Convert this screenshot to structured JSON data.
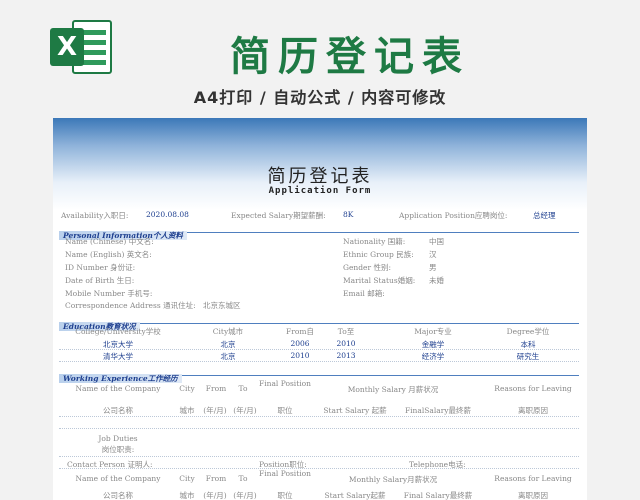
{
  "banner": {
    "icon_letter": "X",
    "title": "简历登记表",
    "subtitle": "A4打印 / 自动公式 / 内容可修改",
    "accent": "#1e7a44"
  },
  "doc": {
    "title": "简历登记表",
    "subtitle": "Application Form",
    "top_row": {
      "availability_label": "Availability入职日:",
      "availability_value": "2020.08.08",
      "salary_label": "Expected Salary期望薪酬:",
      "salary_value": "8K",
      "position_label": "Application Position应聘岗位:",
      "position_value": "总经理"
    },
    "personal": {
      "header": "Personal Information个人资料",
      "name_cn": "Name (Chinese) 中文名:",
      "name_en": "Name (English) 英文名:",
      "id": "ID Number 身份证:",
      "dob": "Date of Birth 生日:",
      "mobile": "Mobile Number 手机号:",
      "address_label": "Correspondence Address 通讯住址:",
      "address_value": "北京东城区",
      "nationality_label": "Nationality 国籍:",
      "nationality_value": "中国",
      "ethnic_label": "Ethnic Group 民族:",
      "ethnic_value": "汉",
      "gender_label": "Gender 性别:",
      "gender_value": "男",
      "marital_label": "Marital Status婚姻:",
      "marital_value": "未婚",
      "email": "Email 邮箱:"
    },
    "education": {
      "header": "Education教育状况",
      "columns": [
        "College/University学校",
        "City城市",
        "From自",
        "To至",
        "Major专业",
        "Degree学位"
      ],
      "rows": [
        [
          "北京大学",
          "北京",
          "2006",
          "2010",
          "金融学",
          "本科"
        ],
        [
          "清华大学",
          "北京",
          "2010",
          "2013",
          "经济学",
          "研究生"
        ]
      ]
    },
    "work": {
      "header": "Working Experience工作经历",
      "columns_en": [
        "Name of the Company",
        "City",
        "From",
        "To",
        "Final Position",
        "Monthly Salary 月薪状况",
        "Reasons for Leaving"
      ],
      "columns_cn": [
        "公司名称",
        "城市",
        "(年/月)",
        "(年/月)",
        "职位",
        "Start Salary 起薪",
        "FinalSalary最终薪",
        "离职原因"
      ],
      "job_duties": "Job Duties",
      "job_duties_cn": "岗位职责:",
      "contact_label": "Contact Person 证明人:",
      "contact_position": "Position职位:",
      "contact_phone": "Telephone电话:",
      "columns_en2": [
        "Name of the Company",
        "City",
        "From",
        "To",
        "Final Position",
        "Monthly Salary月薪状况",
        "Reasons for Leaving"
      ],
      "columns_cn2": [
        "公司名称",
        "城市",
        "(年/月)",
        "(年/月)",
        "职位",
        "Start Salary起薪",
        "Final Salary最终薪",
        "离职原因"
      ]
    }
  }
}
